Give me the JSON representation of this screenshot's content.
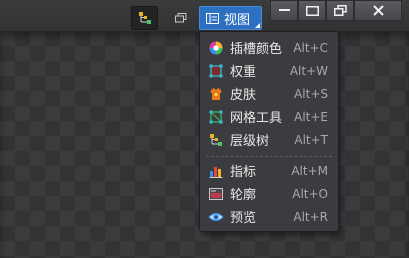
{
  "toolbar": {
    "hierarchy_button_icon": "hierarchy-icon",
    "layers_button_icon": "layers-icon",
    "view_button": {
      "label": "视图",
      "icon": "view-icon",
      "accent": "#2d6fc0"
    }
  },
  "window_controls": {
    "minimize_icon": "minimize-icon",
    "maximize_icon": "maximize-icon",
    "restore_icon": "restore-icon",
    "close_icon": "close-icon"
  },
  "menu": {
    "items": [
      {
        "label": "插槽颜色",
        "shortcut": "Alt+C",
        "icon": "color-wheel-icon"
      },
      {
        "label": "权重",
        "shortcut": "Alt+W",
        "icon": "weight-icon"
      },
      {
        "label": "皮肤",
        "shortcut": "Alt+S",
        "icon": "skin-icon"
      },
      {
        "label": "网格工具",
        "shortcut": "Alt+E",
        "icon": "mesh-tool-icon"
      },
      {
        "label": "层级树",
        "shortcut": "Alt+T",
        "icon": "hierarchy-tree-icon"
      },
      {
        "label": "指标",
        "shortcut": "Alt+M",
        "icon": "metrics-icon"
      },
      {
        "label": "轮廓",
        "shortcut": "Alt+O",
        "icon": "outline-icon"
      },
      {
        "label": "预览",
        "shortcut": "Alt+R",
        "icon": "preview-icon"
      }
    ]
  }
}
